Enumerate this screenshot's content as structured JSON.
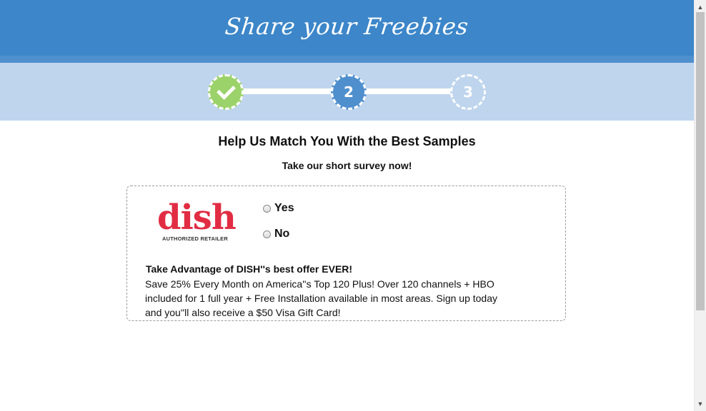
{
  "header": {
    "title": "Share your Freebies"
  },
  "steps": [
    {
      "label": "",
      "state": "complete",
      "icon": "check-icon",
      "color": "#9bd26a"
    },
    {
      "label": "2",
      "state": "current",
      "color": "#4f8fcd"
    },
    {
      "label": "3",
      "state": "upcoming",
      "color": "#bfd5ee"
    }
  ],
  "main": {
    "headline": "Help Us Match You With the Best Samples",
    "subline": "Take our short survey now!"
  },
  "offer": {
    "logo": {
      "wordmark": "dish",
      "tagline": "AUTHORIZED RETAILER",
      "color": "#e12c43"
    },
    "options": [
      {
        "label": "Yes",
        "checked": false
      },
      {
        "label": "No",
        "checked": false
      }
    ],
    "title": "Take Advantage of DISH''s best offer EVER!",
    "description": "Save 25% Every Month on America''s Top 120 Plus! Over 120 channels + HBO included for 1 full year + Free Installation available in most areas. Sign up today and you''ll also receive a $50 Visa Gift Card!"
  },
  "colors": {
    "header": "#3c86c9",
    "band": "#bfd5ee",
    "accent_green": "#9bd26a"
  }
}
